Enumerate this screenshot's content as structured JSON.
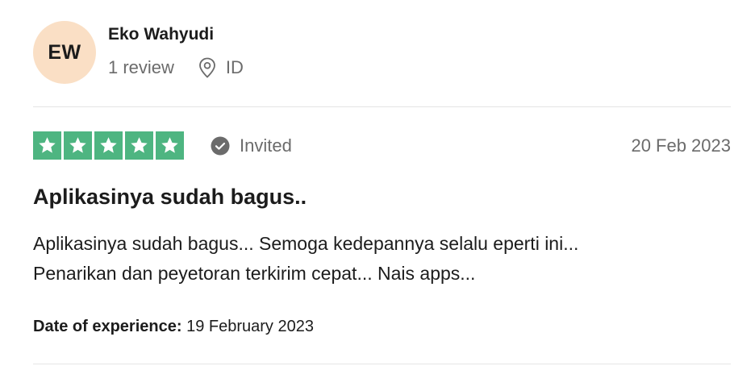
{
  "reviewer": {
    "initials": "EW",
    "name": "Eko Wahyudi",
    "review_count": "1 review",
    "country": "ID"
  },
  "review": {
    "rating": 5,
    "rating_max": 5,
    "status": "Invited",
    "date": "20 Feb 2023",
    "title": "Aplikasinya sudah bagus..",
    "body_lines": [
      "Aplikasinya sudah bagus... Semoga kedepannya selalu eperti ini...",
      "Penarikan dan peyetoran terkirim cepat... Nais apps..."
    ],
    "experience_label": "Date of experience:",
    "experience_date": "19 February 2023"
  },
  "colors": {
    "star_green": "#4eb581",
    "avatar_bg": "#fadfc5",
    "muted_text": "#6b6b6b",
    "divider": "#e5e5e5"
  },
  "icons": {
    "location": "location-pin-icon",
    "invited": "check-circle-icon",
    "star": "star-icon"
  }
}
